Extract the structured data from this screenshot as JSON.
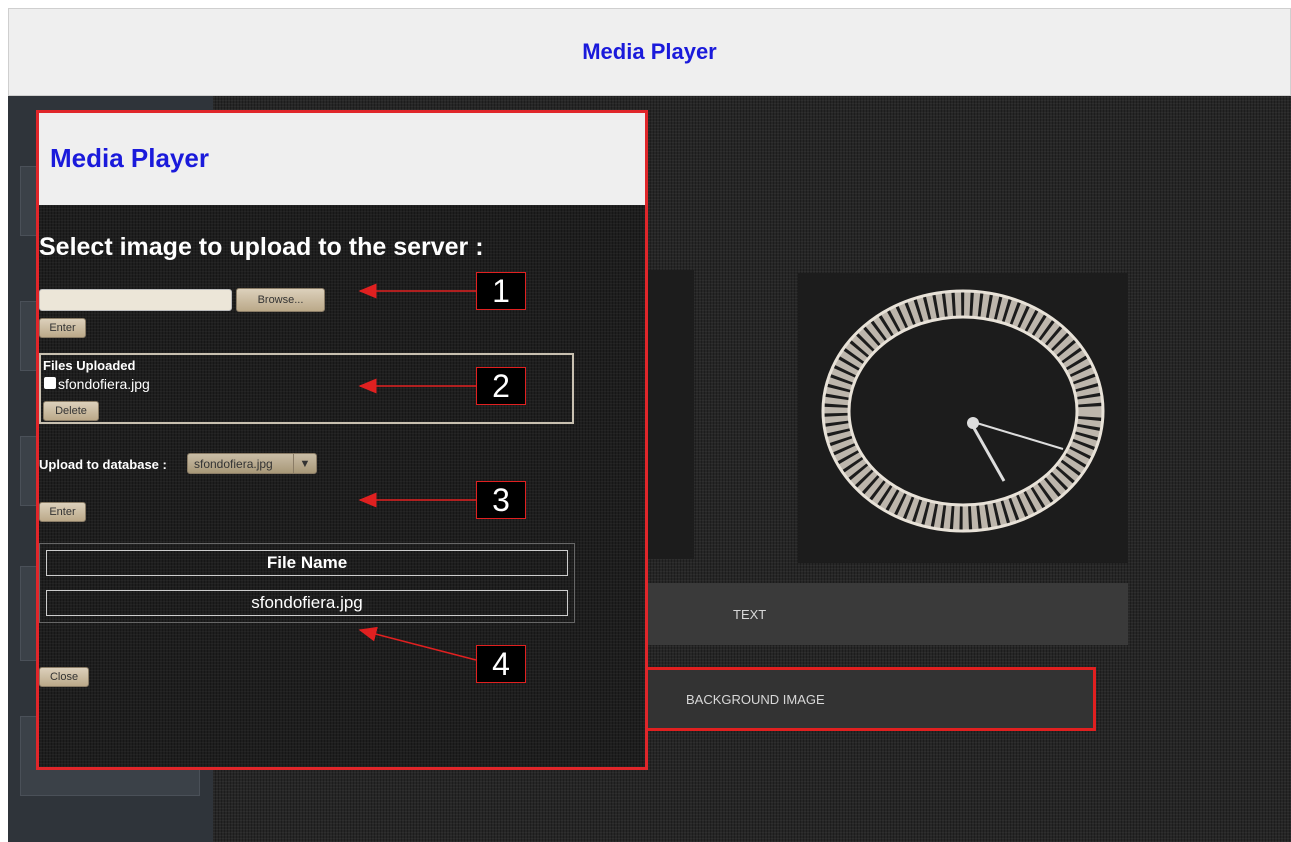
{
  "app": {
    "title": "Media Player"
  },
  "dialog": {
    "title": "Media Player",
    "heading": "Select image to upload to the server :",
    "browse_label": "Browse...",
    "enter_label": "Enter",
    "files_uploaded_label": "Files Uploaded",
    "uploaded_files": [
      "sfondofiera.jpg"
    ],
    "delete_label": "Delete",
    "upload_db_label": "Upload to database :",
    "db_selected": "sfondofiera.jpg",
    "db_enter_label": "Enter",
    "table": {
      "header": "File Name",
      "rows": [
        "sfondofiera.jpg"
      ]
    },
    "close_label": "Close"
  },
  "background": {
    "text_bar": "TEXT",
    "background_image_bar": "BACKGROUND IMAGE"
  },
  "annotations": [
    "1",
    "2",
    "3",
    "4"
  ]
}
